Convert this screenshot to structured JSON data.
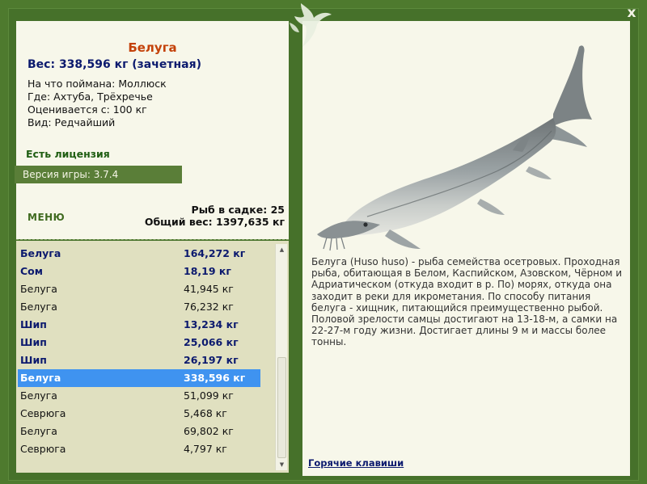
{
  "close_label": "x",
  "info": {
    "fish_name": "Белуга",
    "weight_line": "Вес: 338,596 кг (зачетная)",
    "details": [
      "На что поймана: Моллюск",
      "Где: Ахтуба, Трёхречье",
      "Оценивается с: 100 кг",
      "Вид: Редчайший"
    ],
    "license": "Есть лицензия",
    "version": "Версия игры: 3.7.4",
    "menu_label": "МЕНЮ",
    "stats": {
      "fish_count": "Рыб в садке: 25",
      "total_weight": "Общий вес: 1397,635 кг"
    }
  },
  "catch_list": [
    {
      "name": "Белуга",
      "weight": "164,272 кг",
      "highlight": true,
      "selected": false
    },
    {
      "name": "Сом",
      "weight": "18,19 кг",
      "highlight": true,
      "selected": false
    },
    {
      "name": "Белуга",
      "weight": "41,945 кг",
      "highlight": false,
      "selected": false
    },
    {
      "name": "Белуга",
      "weight": "76,232 кг",
      "highlight": false,
      "selected": false
    },
    {
      "name": "Шип",
      "weight": "13,234 кг",
      "highlight": true,
      "selected": false
    },
    {
      "name": "Шип",
      "weight": "25,066 кг",
      "highlight": true,
      "selected": false
    },
    {
      "name": "Шип",
      "weight": "26,197 кг",
      "highlight": true,
      "selected": false
    },
    {
      "name": "Белуга",
      "weight": "338,596 кг",
      "highlight": true,
      "selected": true
    },
    {
      "name": "Белуга",
      "weight": "51,099 кг",
      "highlight": false,
      "selected": false
    },
    {
      "name": "Севрюга",
      "weight": "5,468 кг",
      "highlight": false,
      "selected": false
    },
    {
      "name": "Белуга",
      "weight": "69,802 кг",
      "highlight": false,
      "selected": false
    },
    {
      "name": "Севрюга",
      "weight": "4,797 кг",
      "highlight": false,
      "selected": false
    }
  ],
  "description": "Белуга (Huso huso) - рыба семейства осетровых. Проходная рыба, обитающая в Белом, Каспийском, Азовском, Чёрном и Адриатическом (откуда входит в р. По) морях, откуда она заходит в реки для икрометания. По способу питания белуга - хищник, питающийся преимущественно рыбой. Половой зрелости самцы достигают на 13-18-м, а самки на 22-27-м году жизни. Достигает длины 9 м и массы более тонны.",
  "hotkeys_label": "Горячие клавиши",
  "icons": {
    "logo": "fish-silhouette-icon",
    "close": "close-icon",
    "scroll_up": "arrow-up-icon",
    "scroll_down": "arrow-down-icon"
  },
  "colors": {
    "frame": "#4e7a2e",
    "panel": "#f7f7ea",
    "list_bg": "#e0e0c0",
    "title": "#c4420a",
    "accent_text": "#0c1a6e",
    "selected_row": "#3f93f0"
  }
}
